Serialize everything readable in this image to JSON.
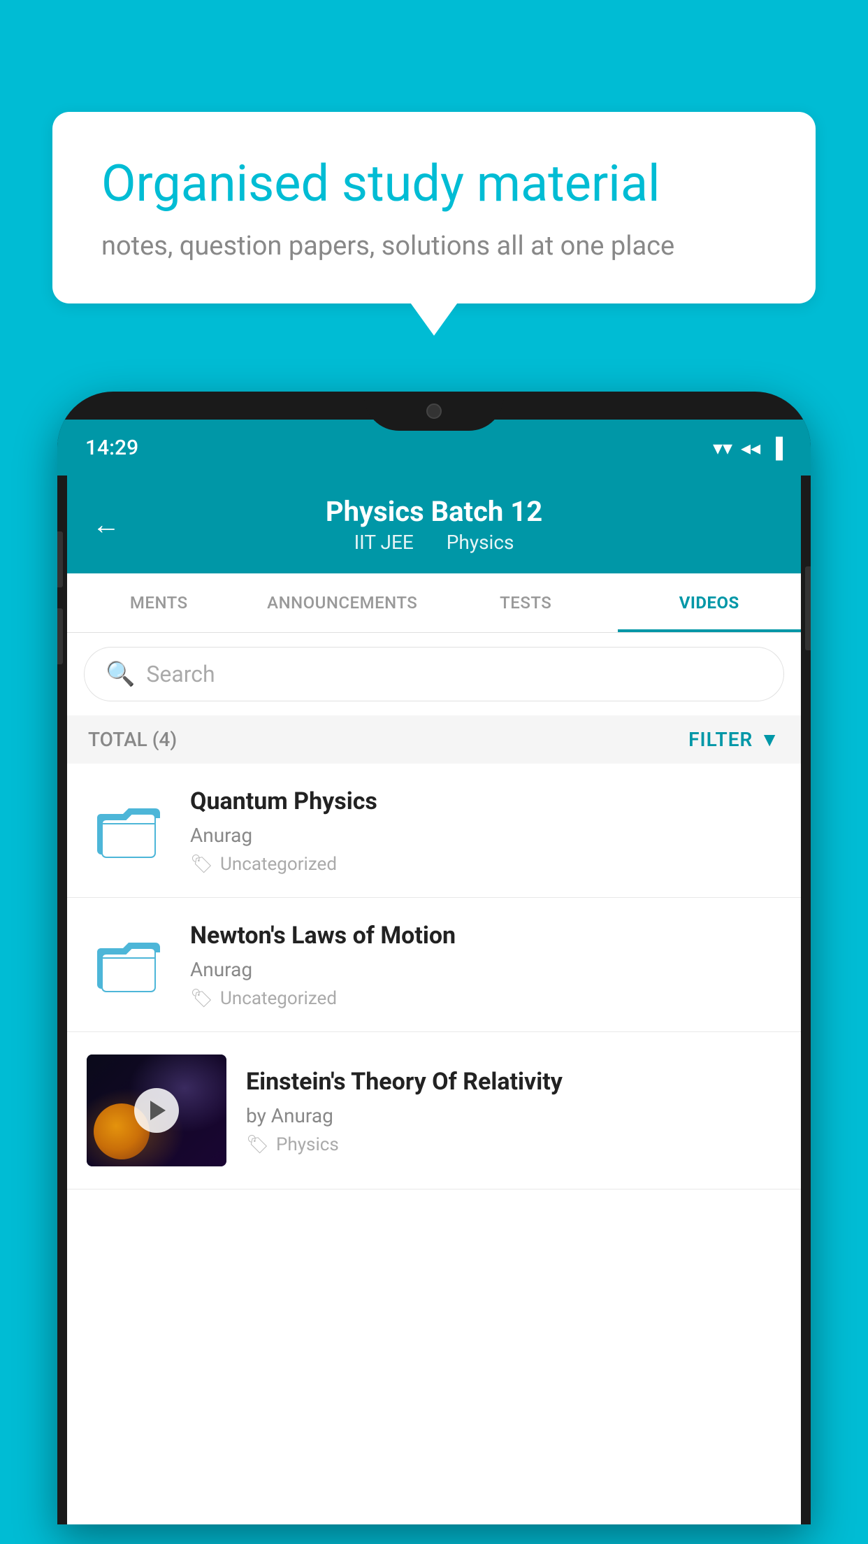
{
  "background": {
    "color": "#00bcd4"
  },
  "speech_bubble": {
    "title": "Organised study material",
    "subtitle": "notes, question papers, solutions all at one place"
  },
  "phone": {
    "status_bar": {
      "time": "14:29",
      "wifi_icon": "▼",
      "signal_icon": "◄",
      "battery_icon": "▌"
    },
    "header": {
      "back_label": "←",
      "title": "Physics Batch 12",
      "subtitle_part1": "IIT JEE",
      "subtitle_part2": "Physics"
    },
    "tabs": [
      {
        "label": "MENTS",
        "active": false
      },
      {
        "label": "ANNOUNCEMENTS",
        "active": false
      },
      {
        "label": "TESTS",
        "active": false
      },
      {
        "label": "VIDEOS",
        "active": true
      }
    ],
    "search": {
      "placeholder": "Search"
    },
    "filter_bar": {
      "total_label": "TOTAL (4)",
      "filter_label": "FILTER"
    },
    "videos": [
      {
        "title": "Quantum Physics",
        "author": "Anurag",
        "tag": "Uncategorized",
        "type": "folder"
      },
      {
        "title": "Newton's Laws of Motion",
        "author": "Anurag",
        "tag": "Uncategorized",
        "type": "folder"
      },
      {
        "title": "Einstein's Theory Of Relativity",
        "author": "by Anurag",
        "tag": "Physics",
        "type": "video"
      }
    ]
  }
}
